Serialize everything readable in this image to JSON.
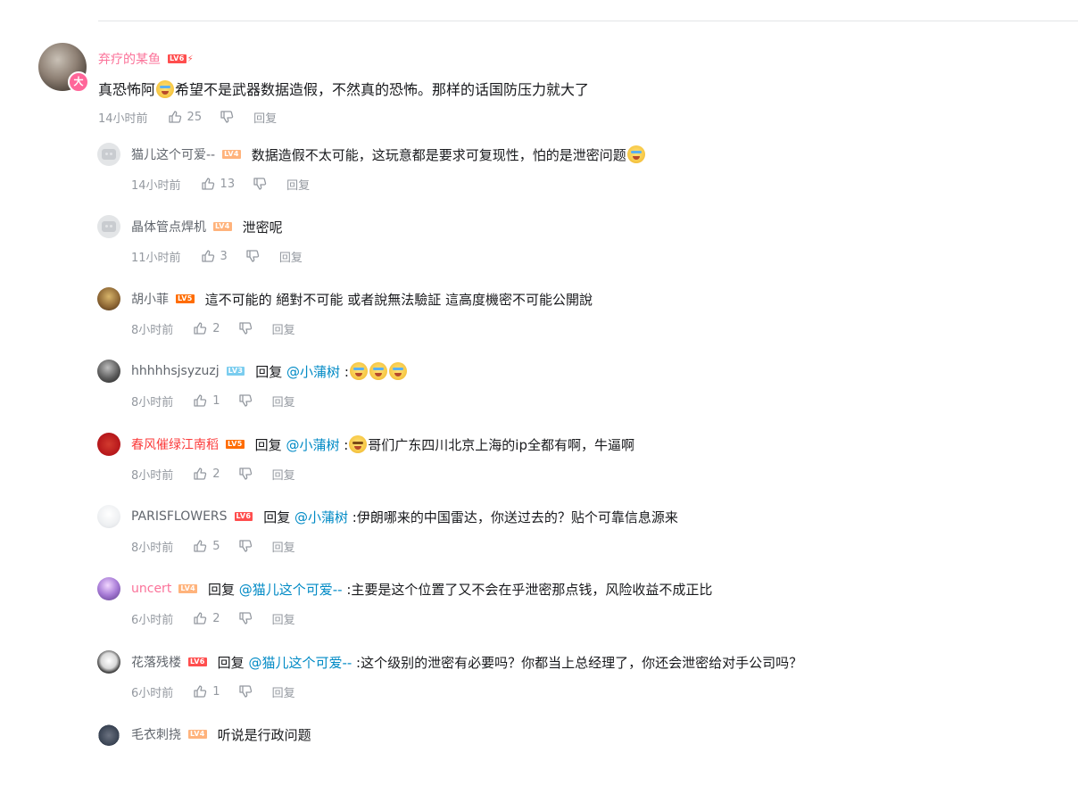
{
  "main_comment": {
    "username": "弃疗的某鱼",
    "level": "LV6",
    "content_before": "真恐怖阿",
    "content_after": "希望不是武器数据造假，不然真的恐怖。那样的话国防压力就大了",
    "time": "14小时前",
    "likes": "25",
    "reply_label": "回复",
    "pendant_text": "大"
  },
  "replies": [
    {
      "username": "猫儿这个可爱--",
      "level": "LV4",
      "text": "数据造假不太可能，这玩意都是要求可复现性，怕的是泄密问题",
      "time": "14小时前",
      "likes": "13",
      "reply_label": "回复"
    },
    {
      "username": "晶体管点焊机",
      "level": "LV4",
      "text": "泄密呢",
      "time": "11小时前",
      "likes": "3",
      "reply_label": "回复"
    },
    {
      "username": "胡小菲",
      "level": "LV5",
      "text": "這不可能的 絕對不可能 或者說無法驗証 這高度機密不可能公開說",
      "time": "8小时前",
      "likes": "2",
      "reply_label": "回复"
    },
    {
      "username": "hhhhhsjsyzuzj",
      "level": "LV3",
      "reply_word": "回复",
      "mention": "@小蒲树",
      "text": " :",
      "time": "8小时前",
      "likes": "1",
      "reply_label": "回复"
    },
    {
      "username": "春风催绿江南稻",
      "level": "LV5",
      "reply_word": "回复",
      "mention": "@小蒲树",
      "text": "哥们广东四川北京上海的ip全都有啊，牛逼啊",
      "text_prefix": " :",
      "time": "8小时前",
      "likes": "2",
      "reply_label": "回复"
    },
    {
      "username": "PARISFLOWERS",
      "level": "LV6",
      "reply_word": "回复",
      "mention": "@小蒲树",
      "text": " :伊朗哪来的中国雷达，你送过去的？贴个可靠信息源来",
      "time": "8小时前",
      "likes": "5",
      "reply_label": "回复"
    },
    {
      "username": "uncert",
      "level": "LV4",
      "reply_word": "回复",
      "mention": "@猫儿这个可爱--",
      "text": " :主要是这个位置了又不会在乎泄密那点钱，风险收益不成正比",
      "time": "6小时前",
      "likes": "2",
      "reply_label": "回复"
    },
    {
      "username": "花落残楼",
      "level": "LV6",
      "reply_word": "回复",
      "mention": "@猫儿这个可爱--",
      "text": " :这个级别的泄密有必要吗？你都当上总经理了，你还会泄密给对手公司吗？",
      "time": "6小时前",
      "likes": "1",
      "reply_label": "回复"
    },
    {
      "username": "毛衣刺挠",
      "level": "LV4",
      "text": "听说是行政问题"
    }
  ]
}
